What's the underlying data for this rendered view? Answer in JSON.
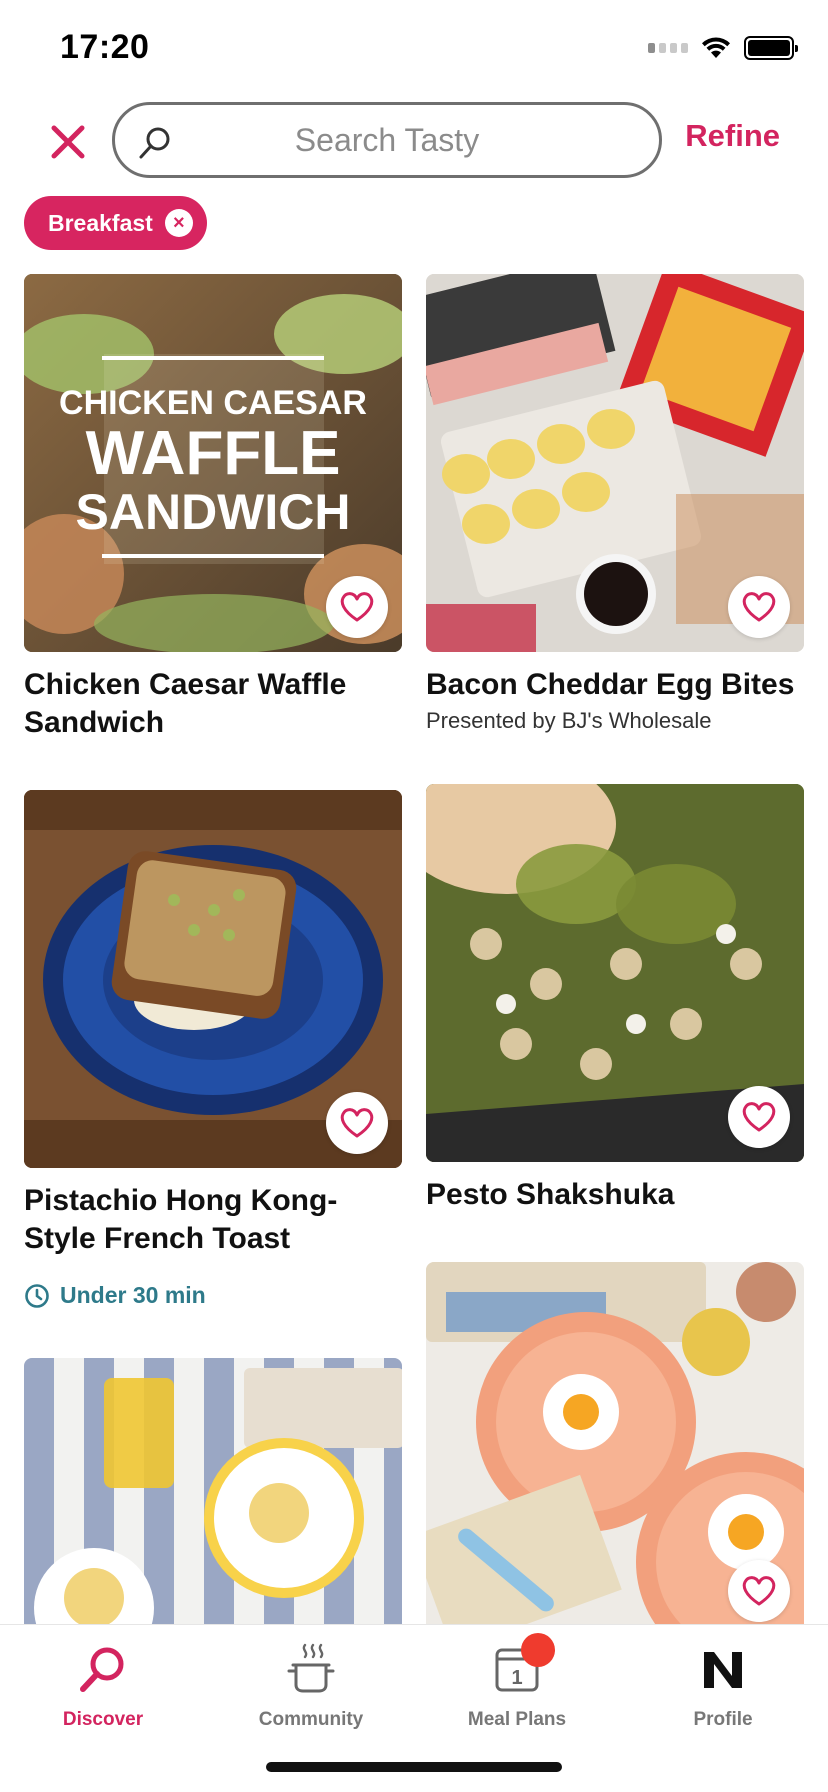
{
  "status_bar": {
    "time": "17:20"
  },
  "search": {
    "placeholder": "Search Tasty",
    "refine_label": "Refine"
  },
  "filters": [
    {
      "label": "Breakfast"
    }
  ],
  "cards": [
    {
      "title": "Chicken Caesar Waffle Sandwich",
      "image_text": [
        "CHICKEN CAESAR",
        "WAFFLE",
        "SANDWICH"
      ]
    },
    {
      "title": "Bacon Cheddar Egg Bites",
      "subtitle": "Presented by BJ's Wholesale"
    },
    {
      "title": "Pistachio Hong Kong-Style French Toast",
      "meta": "Under 30 min"
    },
    {
      "title": "Pesto Shakshuka"
    },
    {
      "title": ""
    },
    {
      "title": ""
    }
  ],
  "tabs": [
    {
      "label": "Discover",
      "icon": "search-icon",
      "active": true
    },
    {
      "label": "Community",
      "icon": "pot-icon",
      "active": false
    },
    {
      "label": "Meal Plans",
      "icon": "calendar-icon",
      "active": false,
      "calendar_day": "1"
    },
    {
      "label": "Profile",
      "icon": "profile-n-icon",
      "active": false
    }
  ],
  "colors": {
    "accent": "#d3245f",
    "teal": "#2e7a8a",
    "badge": "#ef3b2e"
  }
}
